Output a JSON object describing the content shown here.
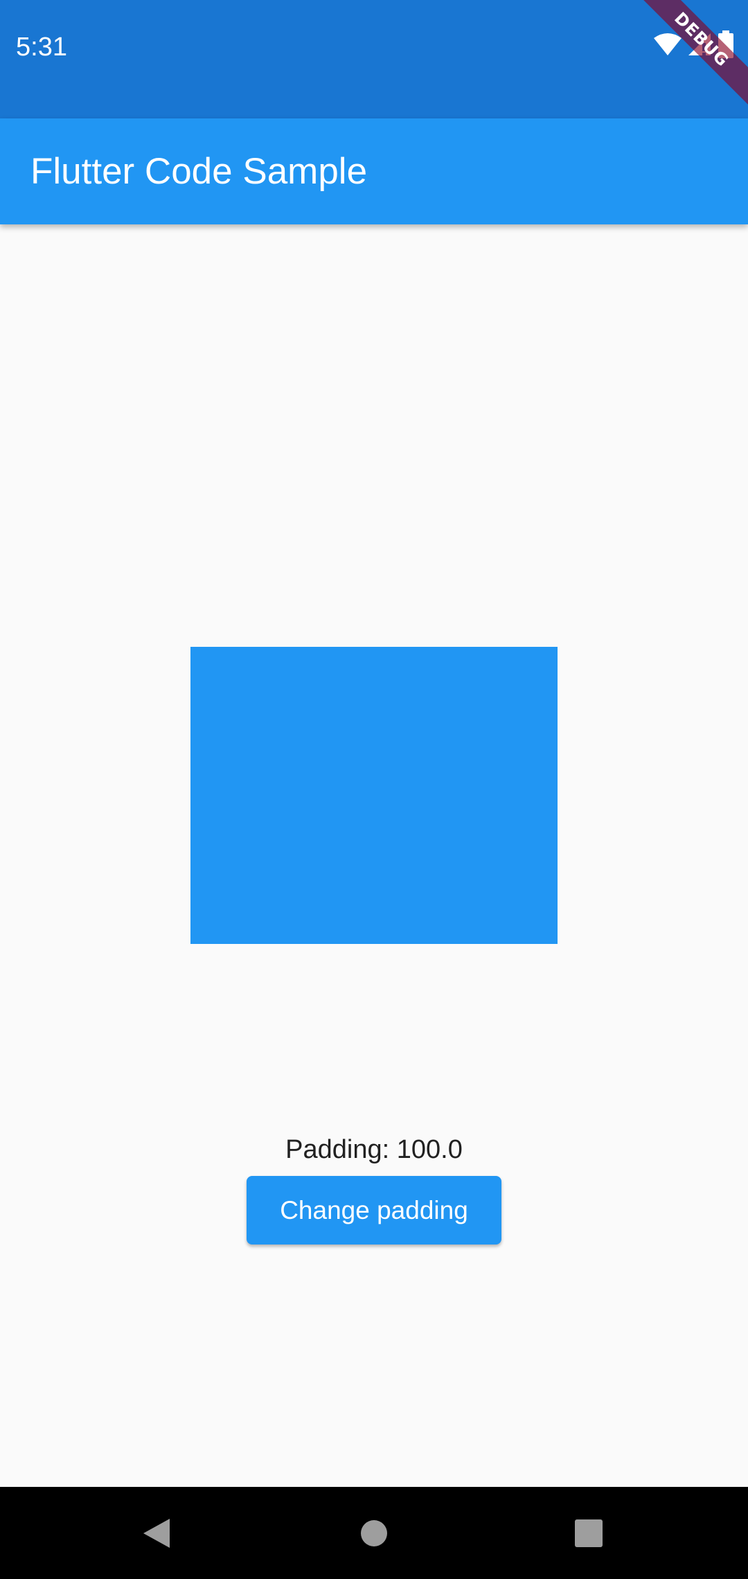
{
  "status_bar": {
    "time": "5:31",
    "icons": [
      "wifi-icon",
      "cell-signal-icon",
      "battery-icon"
    ],
    "color": "#1976d2"
  },
  "debug_banner": {
    "label": "DEBUG"
  },
  "app_bar": {
    "title": "Flutter Code Sample",
    "color": "#2196f3"
  },
  "main": {
    "box_color": "#2196f3",
    "padding_label": "Padding: 100.0",
    "change_button_label": "Change padding"
  },
  "nav_bar": {
    "icons": [
      "back-icon",
      "home-icon",
      "recents-icon"
    ]
  }
}
